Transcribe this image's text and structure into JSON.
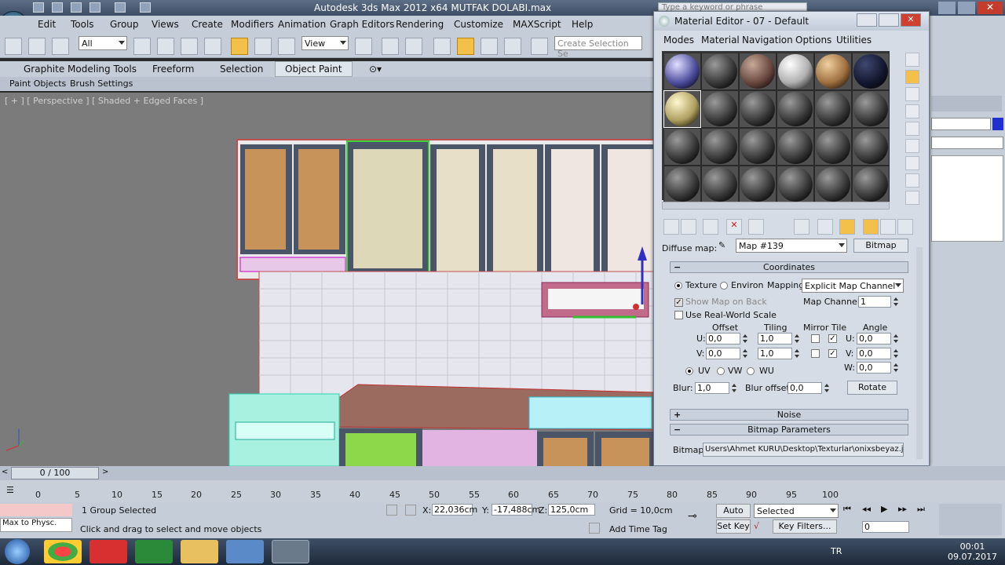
{
  "window": {
    "title": "Autodesk 3ds Max 2012 x64      MUTFAK DOLABI.max"
  },
  "search": {
    "placeholder": "Type a keyword or phrase"
  },
  "menu": [
    "Edit",
    "Tools",
    "Group",
    "Views",
    "Create",
    "Modifiers",
    "Animation",
    "Graph Editors",
    "Rendering",
    "Customize",
    "MAXScript",
    "Help"
  ],
  "toolbar": {
    "filter_value": "All",
    "ref_coord_value": "View",
    "selection_set_placeholder": "Create Selection Se"
  },
  "ribbon": {
    "tabs": [
      "Graphite Modeling Tools",
      "Freeform",
      "Selection",
      "Object Paint"
    ],
    "active": "Object Paint",
    "subtabs": [
      "Paint Objects",
      "Brush Settings"
    ]
  },
  "viewport": {
    "label": "[ + ] [ Perspective ] [ Shaded + Edged Faces ]"
  },
  "material_editor": {
    "title": "Material Editor - 07 - Default",
    "menu": [
      "Modes",
      "Material",
      "Navigation",
      "Options",
      "Utilities"
    ],
    "diffuse_label": "Diffuse map:",
    "map_name": "Map #139",
    "map_type": "Bitmap",
    "coordinates": {
      "header": "Coordinates",
      "texture": "Texture",
      "environ": "Environ",
      "mapping_label": "Mapping:",
      "mapping_value": "Explicit Map Channel",
      "show_map_on_back": "Show Map on Back",
      "map_channel_label": "Map Channel:",
      "map_channel_value": "1",
      "use_real_world": "Use Real-World Scale",
      "col_offset": "Offset",
      "col_tiling": "Tiling",
      "col_mirror_tile": "Mirror Tile",
      "col_angle": "Angle",
      "u_label": "U:",
      "v_label": "V:",
      "w_label": "W:",
      "u_offset": "0,0",
      "v_offset": "0,0",
      "u_tiling": "1,0",
      "v_tiling": "1,0",
      "u_angle": "0,0",
      "v_angle": "0,0",
      "w_angle": "0,0",
      "uv": "UV",
      "vw": "VW",
      "wu": "WU",
      "blur_label": "Blur:",
      "blur_value": "1,0",
      "blur_offset_label": "Blur offset:",
      "blur_offset_value": "0,0",
      "rotate": "Rotate"
    },
    "noise_header": "Noise",
    "bitmap_params_header": "Bitmap Parameters",
    "bitmap_label": "Bitmap:",
    "bitmap_path": "Users\\Ahmet KURU\\Desktop\\Texturlar\\onixsbeyaz.jpg"
  },
  "timeline": {
    "frame": "0 / 100",
    "ticks": [
      "0",
      "5",
      "10",
      "15",
      "20",
      "25",
      "30",
      "35",
      "40",
      "45",
      "50",
      "55",
      "60",
      "65",
      "70",
      "75",
      "80",
      "85",
      "90",
      "95",
      "100"
    ]
  },
  "status": {
    "selection": "1 Group Selected",
    "prompt": "Click and drag to select and move objects",
    "maxscript": "Max to Physc.",
    "x_label": "X:",
    "x_value": "22,036cm",
    "y_label": "Y:",
    "y_value": "-17,488cm",
    "z_label": "Z:",
    "z_value": "125,0cm",
    "grid": "Grid = 10,0cm",
    "auto_key": "Auto Key",
    "set_key": "Set Key",
    "key_mode": "Selected",
    "key_filters": "Key Filters...",
    "add_time_tag": "Add Time Tag",
    "frame_field": "0"
  },
  "taskbar": {
    "lang": "TR",
    "time": "00:01",
    "date": "09.07.2017"
  }
}
